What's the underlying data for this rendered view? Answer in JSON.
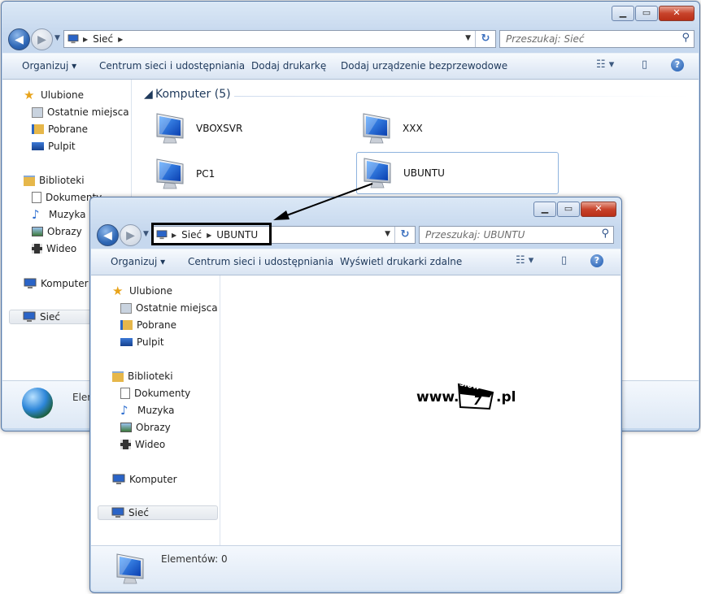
{
  "window_back": {
    "address": [
      "Sieć"
    ],
    "search_placeholder": "Przeszukaj: Sieć",
    "toolbar": [
      "Organizuj ▾",
      "Centrum sieci i udostępniania",
      "Dodaj drukarkę",
      "Dodaj urządzenie bezprzewodowe"
    ],
    "nav": {
      "favorites": "Ulubione",
      "recent": "Ostatnie miejsca",
      "downloads": "Pobrane",
      "desktop": "Pulpit",
      "libraries": "Biblioteki",
      "documents": "Dokumenty",
      "music": "Muzyka",
      "pictures": "Obrazy",
      "videos": "Wideo",
      "computer": "Komputer",
      "network": "Sieć"
    },
    "group_header": "Komputer (5)",
    "computers": [
      "VBOXSVR",
      "XXX",
      "PC1",
      "UBUNTU"
    ],
    "details_text": "Elem"
  },
  "window_front": {
    "address": [
      "Sieć",
      "UBUNTU"
    ],
    "search_placeholder": "Przeszukaj: UBUNTU",
    "toolbar": [
      "Organizuj ▾",
      "Centrum sieci i udostępniania",
      "Wyświetl drukarki zdalne"
    ],
    "nav": {
      "favorites": "Ulubione",
      "recent": "Ostatnie miejsca",
      "downloads": "Pobrane",
      "desktop": "Pulpit",
      "libraries": "Biblioteki",
      "documents": "Dokumenty",
      "music": "Muzyka",
      "pictures": "Obrazy",
      "videos": "Wideo",
      "computer": "Komputer",
      "network": "Sieć"
    },
    "details_text": "Elementów: 0"
  },
  "watermark": {
    "prefix": "www.",
    "logo_top": "slow",
    "logo_num": "7",
    "suffix": ".pl"
  },
  "colors": {
    "accent": "#1e395b",
    "highlight_box": "#000000"
  }
}
